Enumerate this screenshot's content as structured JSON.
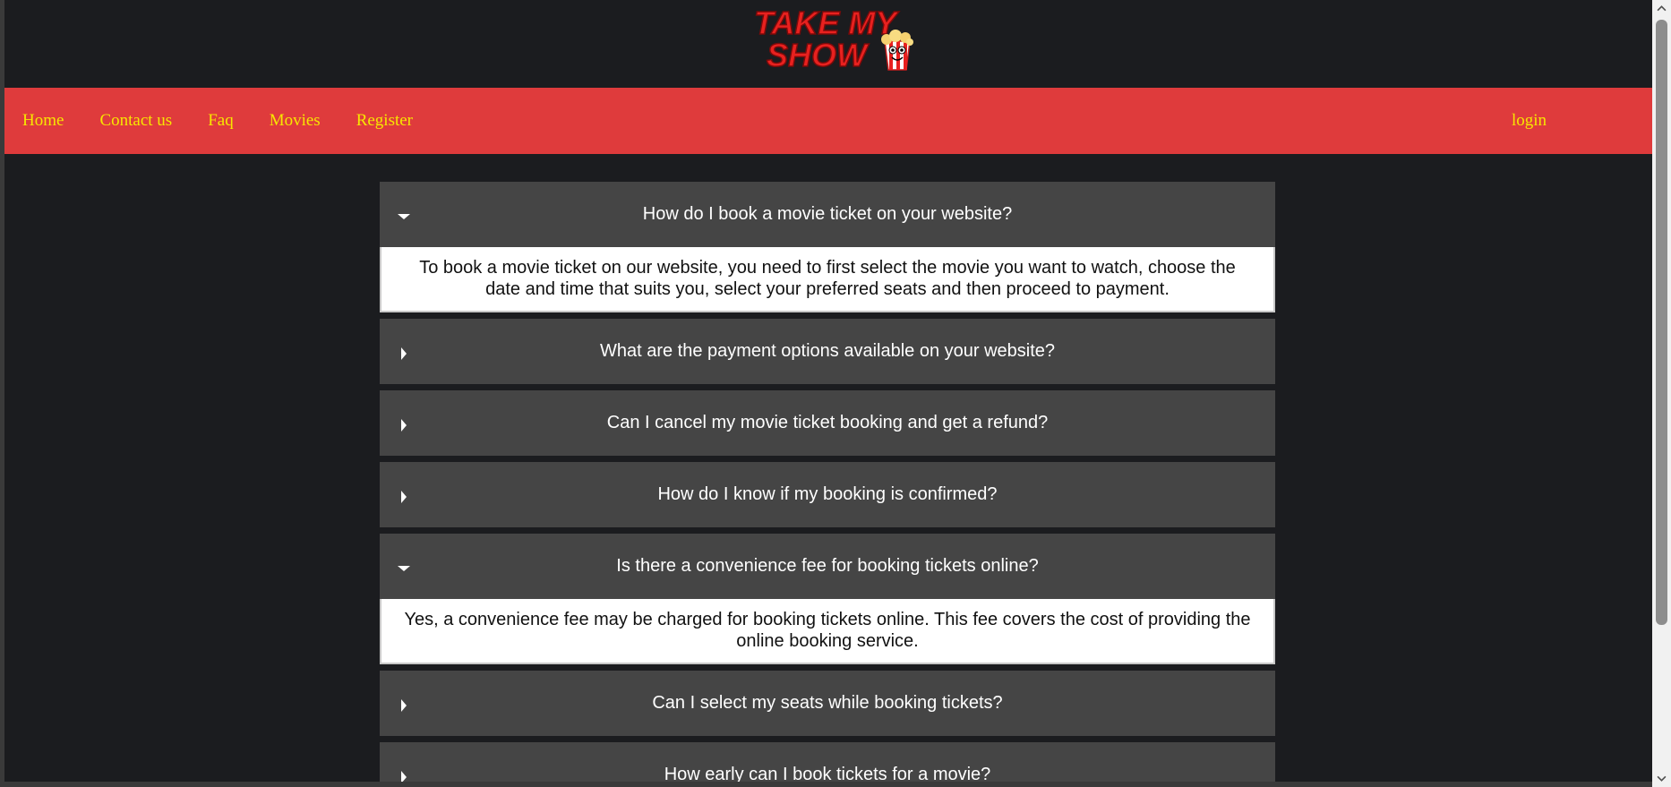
{
  "header": {
    "logo_text_line1": "TAKE MY",
    "logo_text_line2": "SHOW"
  },
  "nav": {
    "items": [
      "Home",
      "Contact us",
      "Faq",
      "Movies",
      "Register"
    ],
    "login": "login"
  },
  "colors": {
    "navbar": "#df3b3c",
    "nav_link": "#f7e600",
    "background": "#1b1c1f",
    "question_bg": "#454545",
    "answer_bg": "#ffffff"
  },
  "faq": [
    {
      "question": "How do I book a movie ticket on your website?",
      "expanded": true,
      "answer": "To book a movie ticket on our website, you need to first select the movie you want to watch, choose the date and time that suits you, select your preferred seats and then proceed to payment."
    },
    {
      "question": "What are the payment options available on your website?",
      "expanded": false
    },
    {
      "question": "Can I cancel my movie ticket booking and get a refund?",
      "expanded": false
    },
    {
      "question": "How do I know if my booking is confirmed?",
      "expanded": false
    },
    {
      "question": "Is there a convenience fee for booking tickets online?",
      "expanded": true,
      "answer": "Yes, a convenience fee may be charged for booking tickets online. This fee covers the cost of providing the online booking service."
    },
    {
      "question": "Can I select my seats while booking tickets?",
      "expanded": false
    },
    {
      "question": "How early can I book tickets for a movie?",
      "expanded": false
    }
  ]
}
